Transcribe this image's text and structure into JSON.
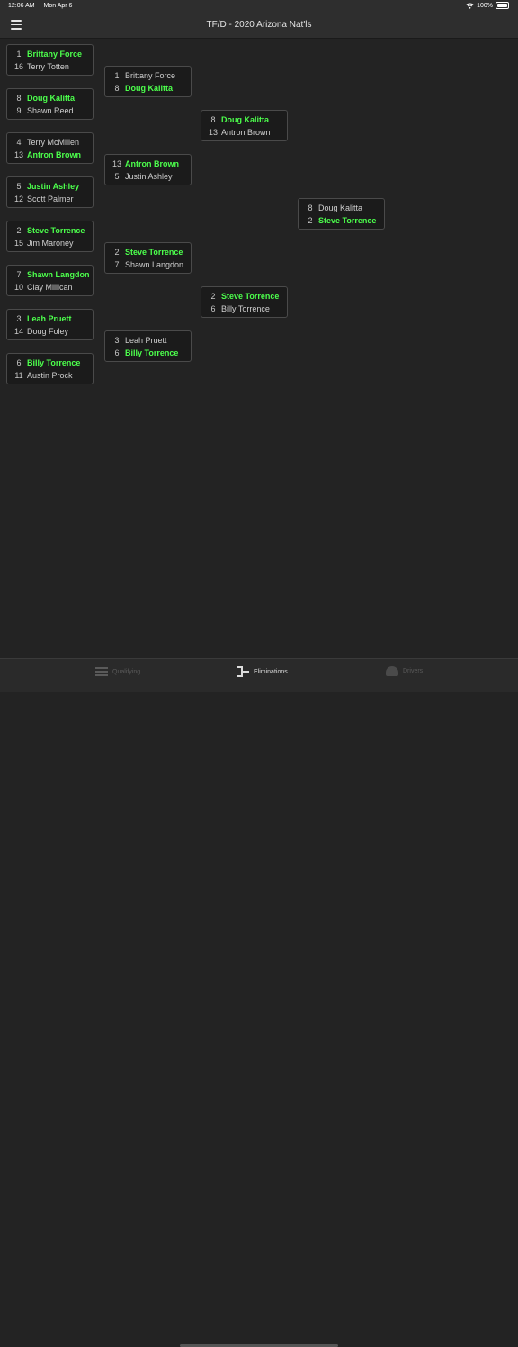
{
  "status": {
    "time": "12:06 AM",
    "date": "Mon Apr 6",
    "battery": "100%"
  },
  "header": {
    "title": "TF/D - 2020 Arizona Nat'ls"
  },
  "bracket": {
    "round1": [
      {
        "top": {
          "seed": "1",
          "name": "Brittany Force",
          "winner": true
        },
        "bottom": {
          "seed": "16",
          "name": "Terry Totten",
          "winner": false
        }
      },
      {
        "top": {
          "seed": "8",
          "name": "Doug Kalitta",
          "winner": true
        },
        "bottom": {
          "seed": "9",
          "name": "Shawn Reed",
          "winner": false
        }
      },
      {
        "top": {
          "seed": "4",
          "name": "Terry McMillen",
          "winner": false
        },
        "bottom": {
          "seed": "13",
          "name": "Antron Brown",
          "winner": true
        }
      },
      {
        "top": {
          "seed": "5",
          "name": "Justin Ashley",
          "winner": true
        },
        "bottom": {
          "seed": "12",
          "name": "Scott Palmer",
          "winner": false
        }
      },
      {
        "top": {
          "seed": "2",
          "name": "Steve Torrence",
          "winner": true
        },
        "bottom": {
          "seed": "15",
          "name": "Jim Maroney",
          "winner": false
        }
      },
      {
        "top": {
          "seed": "7",
          "name": "Shawn Langdon",
          "winner": true
        },
        "bottom": {
          "seed": "10",
          "name": "Clay Millican",
          "winner": false
        }
      },
      {
        "top": {
          "seed": "3",
          "name": "Leah Pruett",
          "winner": true
        },
        "bottom": {
          "seed": "14",
          "name": "Doug Foley",
          "winner": false
        }
      },
      {
        "top": {
          "seed": "6",
          "name": "Billy Torrence",
          "winner": true
        },
        "bottom": {
          "seed": "11",
          "name": "Austin Prock",
          "winner": false
        }
      }
    ],
    "quarterfinals": [
      {
        "top": {
          "seed": "1",
          "name": "Brittany Force",
          "winner": false
        },
        "bottom": {
          "seed": "8",
          "name": "Doug Kalitta",
          "winner": true
        }
      },
      {
        "top": {
          "seed": "13",
          "name": "Antron Brown",
          "winner": true
        },
        "bottom": {
          "seed": "5",
          "name": "Justin Ashley",
          "winner": false
        }
      },
      {
        "top": {
          "seed": "2",
          "name": "Steve Torrence",
          "winner": true
        },
        "bottom": {
          "seed": "7",
          "name": "Shawn Langdon",
          "winner": false
        }
      },
      {
        "top": {
          "seed": "3",
          "name": "Leah Pruett",
          "winner": false
        },
        "bottom": {
          "seed": "6",
          "name": "Billy Torrence",
          "winner": true
        }
      }
    ],
    "semifinals": [
      {
        "top": {
          "seed": "8",
          "name": "Doug Kalitta",
          "winner": true
        },
        "bottom": {
          "seed": "13",
          "name": "Antron Brown",
          "winner": false
        }
      },
      {
        "top": {
          "seed": "2",
          "name": "Steve Torrence",
          "winner": true
        },
        "bottom": {
          "seed": "6",
          "name": "Billy Torrence",
          "winner": false
        }
      }
    ],
    "final": [
      {
        "top": {
          "seed": "8",
          "name": "Doug Kalitta",
          "winner": false
        },
        "bottom": {
          "seed": "2",
          "name": "Steve Torrence",
          "winner": true
        }
      }
    ]
  },
  "tabs": [
    {
      "label": "Qualifying",
      "icon": "list-icon",
      "active": false
    },
    {
      "label": "Eliminations",
      "icon": "bracket-icon",
      "active": true
    },
    {
      "label": "Drivers",
      "icon": "helmet-icon",
      "active": false
    }
  ],
  "colors": {
    "winner": "#4cff4c",
    "background": "#232323",
    "card": "#1b1b1b"
  }
}
